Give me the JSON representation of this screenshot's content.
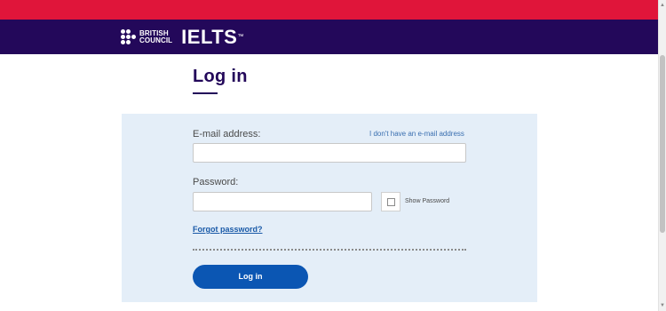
{
  "header": {
    "brand_line1": "BRITISH",
    "brand_line2": "COUNCIL",
    "product": "IELTS",
    "trademark": "™",
    "colors": {
      "stripe": "#e0153a",
      "bar": "#23085a"
    }
  },
  "main": {
    "title": "Log in"
  },
  "form": {
    "email_label": "E-mail address:",
    "no_email_link": "I don't have an e-mail address",
    "email_value": "",
    "password_label": "Password:",
    "password_value": "",
    "show_password_label": "Show Password",
    "forgot_password_link": "Forgot password?",
    "login_button": "Log in",
    "colors": {
      "panel": "#e4eef8",
      "button": "#0b56b3"
    }
  },
  "icons": {
    "brand_logo": "british-council-dots-icon",
    "checkbox": "checkbox-icon"
  }
}
